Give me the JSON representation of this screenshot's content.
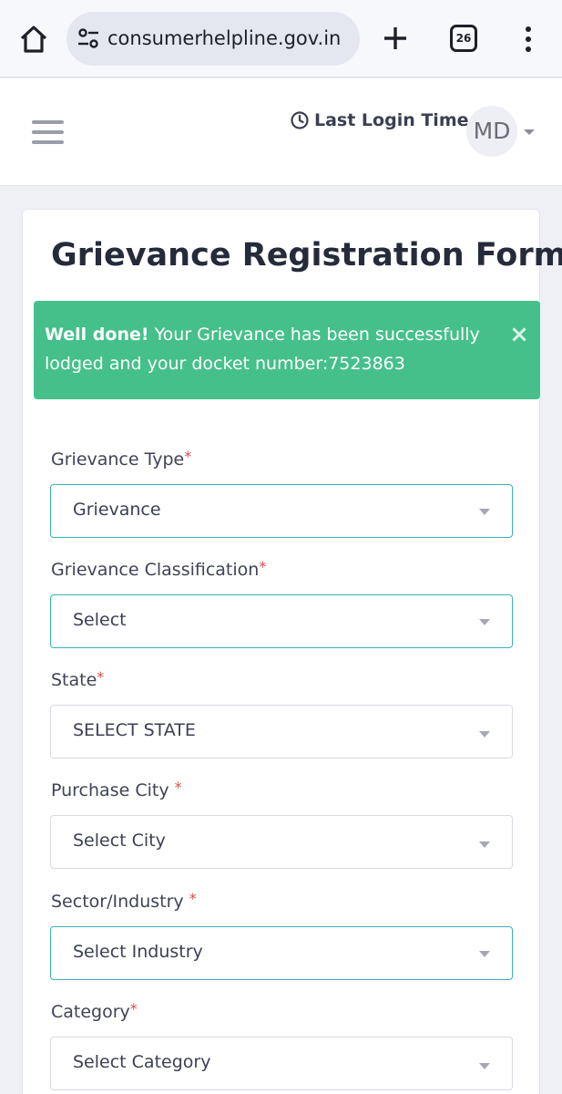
{
  "browser": {
    "url": "consumerhelpline.gov.in",
    "tab_count": "26"
  },
  "header": {
    "last_login_label": "Last Login Time :",
    "avatar_initials": "MD"
  },
  "form": {
    "title": "Grievance Registration Form",
    "alert": {
      "strong": "Well done!",
      "message": " Your Grievance has been successfully lodged and your docket number:7523863",
      "close": "×"
    },
    "fields": [
      {
        "label": "Grievance Type",
        "value": "Grievance",
        "required_mark": "*"
      },
      {
        "label": "Grievance Classification",
        "value": "Select",
        "required_mark": "*"
      },
      {
        "label": "State",
        "value": "SELECT STATE",
        "required_mark": "*"
      },
      {
        "label": "Purchase City ",
        "value": "Select City",
        "required_mark": "*"
      },
      {
        "label": "Sector/Industry ",
        "value": "Select Industry",
        "required_mark": "*"
      },
      {
        "label": "Category",
        "value": "Select Category",
        "required_mark": "*"
      }
    ]
  },
  "colors": {
    "alert_bg": "#45c08a",
    "focus_border": "#3bb0be",
    "required": "#e0494b"
  }
}
